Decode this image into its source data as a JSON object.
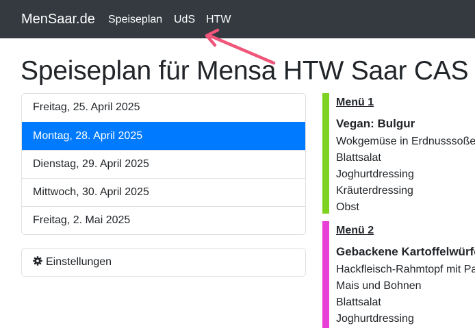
{
  "navbar": {
    "brand": "MenSaar.de",
    "links": [
      "Speiseplan",
      "UdS",
      "HTW"
    ]
  },
  "annotation": {
    "color": "#f0557a",
    "icon": "arrow-icon"
  },
  "page_title": "Speiseplan für Mensa HTW Saar CAS",
  "dates": [
    {
      "label": "Freitag, 25. April 2025",
      "active": false
    },
    {
      "label": "Montag, 28. April 2025",
      "active": true
    },
    {
      "label": "Dienstag, 29. April 2025",
      "active": false
    },
    {
      "label": "Mittwoch, 30. April 2025",
      "active": false
    },
    {
      "label": "Freitag, 2. Mai 2025",
      "active": false
    }
  ],
  "settings": {
    "label": "Einstellungen",
    "icon": "gear-icon"
  },
  "menus": [
    {
      "title": "Menü 1",
      "color": "#7ed321",
      "dish": "Vegan:  Bulgur",
      "items": [
        "Wokgemüse in Erdnusssoße",
        "Blattsalat",
        "Joghurtdressing",
        "Kräuterdressing",
        "Obst"
      ]
    },
    {
      "title": "Menü 2",
      "color": "#e83fd6",
      "dish": "Gebackene Kartoffelwürfel",
      "items": [
        "Hackfleisch-Rahmtopf mit Paprika",
        "Mais und Bohnen",
        "Blattsalat",
        "Joghurtdressing"
      ]
    }
  ],
  "colors": {
    "navbar": "#343a40",
    "active": "#007bff"
  }
}
